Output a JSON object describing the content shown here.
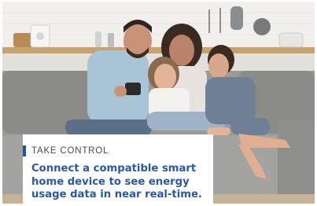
{
  "promo": {
    "eyebrow": "TAKE CONTROL",
    "headline": "Connect a compatible smart home device to see energy usage data in near real-time."
  },
  "colors": {
    "accent": "#2a4f9c",
    "headline": "#2a57a6",
    "eyebrow": "#444b55",
    "sofa": "#8f8f8c",
    "kitchen_wall": "#ececea"
  }
}
